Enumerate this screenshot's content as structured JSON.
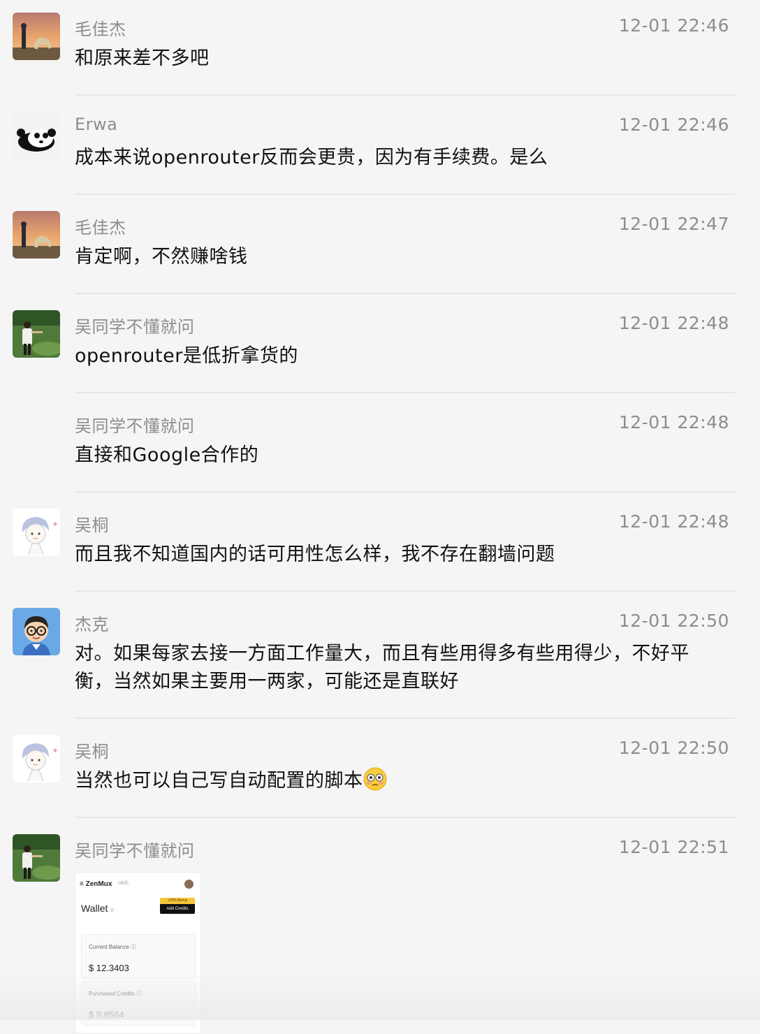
{
  "messages": [
    {
      "sender": "毛佳杰",
      "time": "12-01 22:46",
      "text": "和原来差不多吧",
      "avatar": "sunset-dog"
    },
    {
      "sender": "Erwa",
      "time": "12-01 22:46",
      "text": "成本来说openrouter反而会更贵，因为有手续费。是么",
      "avatar": "panda"
    },
    {
      "sender": "毛佳杰",
      "time": "12-01 22:47",
      "text": "肯定啊，不然赚啥钱",
      "avatar": "sunset-dog"
    },
    {
      "sender": "吴同学不懂就问",
      "time": "12-01 22:48",
      "text": "openrouter是低折拿货的",
      "avatar": "person-grass"
    },
    {
      "sender": "吴同学不懂就问",
      "time": "12-01 22:48",
      "text": "直接和Google合作的",
      "avatar": "none"
    },
    {
      "sender": "吴桐",
      "time": "12-01 22:48",
      "text": "而且我不知道国内的话可用性怎么样，我不存在翻墙问题",
      "avatar": "cartoon-boy"
    },
    {
      "sender": "杰克",
      "time": "12-01 22:50",
      "text": "对。如果每家去接一方面工作量大，而且有些用得多有些用得少，不好平衡，当然如果主要用一两家，可能还是直联好",
      "avatar": "cartoon-glasses"
    },
    {
      "sender": "吴桐",
      "time": "12-01 22:50",
      "text": "当然也可以自己写自动配置的脚本",
      "emoji": "😳",
      "avatar": "cartoon-boy"
    },
    {
      "sender": "吴同学不懂就问",
      "time": "12-01 22:51",
      "text": "",
      "avatar": "person-grass"
    }
  ],
  "image_attachment": {
    "app_name": "≡ ZenMux",
    "version": "v1.0",
    "title": "Wallet",
    "bonus_label": "+25% Bonus",
    "add_credits_label": "Add Credits",
    "current_balance_label": "Current Balance ⓘ",
    "current_balance_value": "$ 12.3403",
    "purchased_credits_label": "Purchased Credits ⓘ",
    "purchased_credits_value": "$ 9.8564"
  },
  "colors": {
    "background": "#f5f5f5",
    "meta_text": "#8d8d8d",
    "body_text": "#111111",
    "divider": "#e6e6e6"
  }
}
